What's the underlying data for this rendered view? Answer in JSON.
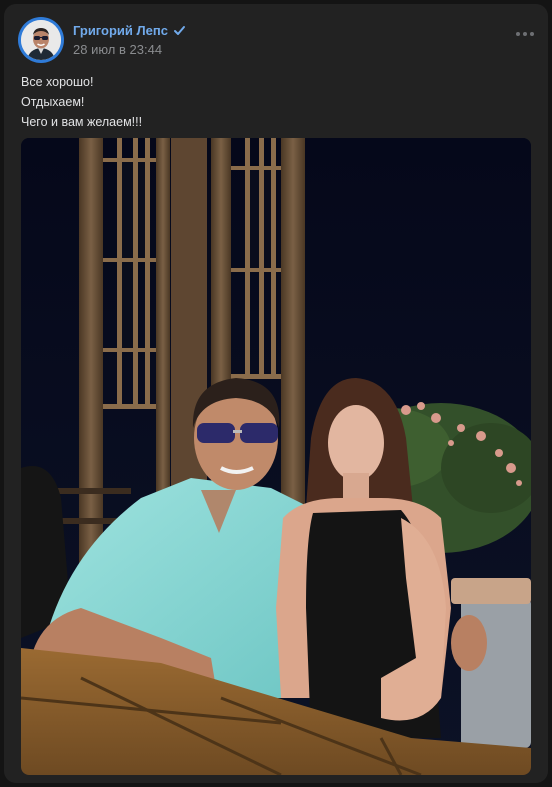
{
  "post": {
    "author_name": "Григорий Лепс",
    "date": "28 июл в 23:44",
    "text_lines": [
      "Все хорошо!",
      "Отдыхаем!",
      "Чего и вам желаем!!!"
    ]
  },
  "icons": {
    "verified": "verified-check-icon",
    "more": "more-dots-icon"
  },
  "colors": {
    "card_background": "#222222",
    "author_link": "#71aaeb",
    "secondary_text": "#8a8c8f",
    "body_text": "#e2e3e5"
  }
}
